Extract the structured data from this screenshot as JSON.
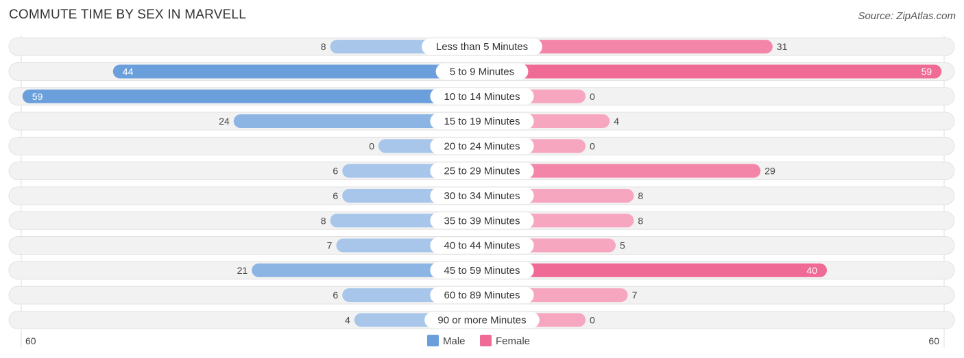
{
  "title": "COMMUTE TIME BY SEX IN MARVELL",
  "source": "Source: ZipAtlas.com",
  "colors": {
    "male_strong": "#6a9fdb",
    "male_light": "#a8c6ea",
    "female_strong": "#f06a96",
    "female_light": "#f7a6c0",
    "track": "#f2f2f2"
  },
  "chart_data": {
    "type": "bar",
    "orientation": "horizontal-diverging",
    "title": "COMMUTE TIME BY SEX IN MARVELL",
    "categories": [
      "Less than 5 Minutes",
      "5 to 9 Minutes",
      "10 to 14 Minutes",
      "15 to 19 Minutes",
      "20 to 24 Minutes",
      "25 to 29 Minutes",
      "30 to 34 Minutes",
      "35 to 39 Minutes",
      "40 to 44 Minutes",
      "45 to 59 Minutes",
      "60 to 89 Minutes",
      "90 or more Minutes"
    ],
    "series": [
      {
        "name": "Male",
        "values": [
          8,
          44,
          59,
          24,
          0,
          6,
          6,
          8,
          7,
          21,
          6,
          4
        ]
      },
      {
        "name": "Female",
        "values": [
          31,
          59,
          0,
          4,
          0,
          29,
          8,
          8,
          5,
          40,
          7,
          0
        ]
      }
    ],
    "axis": {
      "left_label": "60",
      "right_label": "60",
      "max": 60
    },
    "legend": {
      "position": "bottom-center",
      "items": [
        "Male",
        "Female"
      ]
    }
  }
}
